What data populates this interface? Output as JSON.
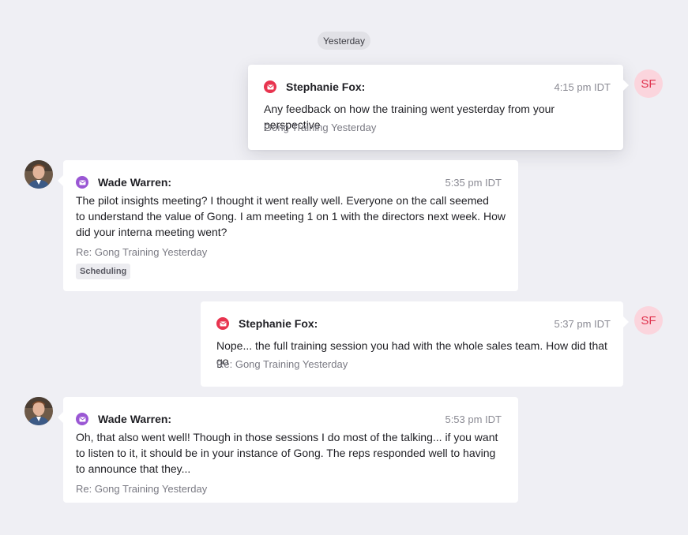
{
  "date_separator": "Yesterday",
  "messages": [
    {
      "sender": "Stephanie Fox:",
      "time": "4:15 pm IDT",
      "body": "Any feedback on how the training went yesterday from your perspective",
      "subject": "Gong Training Yesterday",
      "avatar_initials": "SF",
      "icon": "mail-icon",
      "direction": "outgoing"
    },
    {
      "sender": "Wade Warren:",
      "time": "5:35 pm IDT",
      "body_lines": [
        "The pilot insights meeting? I thought it went really well. Everyone on the call seemed",
        "to understand the value of Gong. I am meeting 1 on 1 with the directors next week. How",
        "did your interna meeting went?"
      ],
      "subject": "Re: Gong Training Yesterday",
      "tag": "Scheduling",
      "icon": "mail-icon",
      "direction": "incoming"
    },
    {
      "sender": "Stephanie Fox:",
      "time": "5:37 pm IDT",
      "body": "Nope... the full training session you had with the whole sales team. How did that go",
      "subject": "Re: Gong Training Yesterday",
      "avatar_initials": "SF",
      "icon": "mail-icon",
      "direction": "outgoing"
    },
    {
      "sender": "Wade Warren:",
      "time": "5:53 pm IDT",
      "body_lines": [
        "Oh, that also went well! Though in those sessions I do most of the talking... if you want",
        "to listen to it, it should be in your instance of Gong. The reps responded well to having",
        "to announce that they..."
      ],
      "subject": "Re: Gong Training Yesterday",
      "icon": "mail-icon",
      "direction": "incoming"
    }
  ],
  "colors": {
    "background": "#efeff4",
    "outgoing_mail_icon": "#e8344f",
    "incoming_mail_icon": "#9a57d4",
    "avatar_bg": "#fbd5dd",
    "avatar_text": "#e0344f"
  }
}
